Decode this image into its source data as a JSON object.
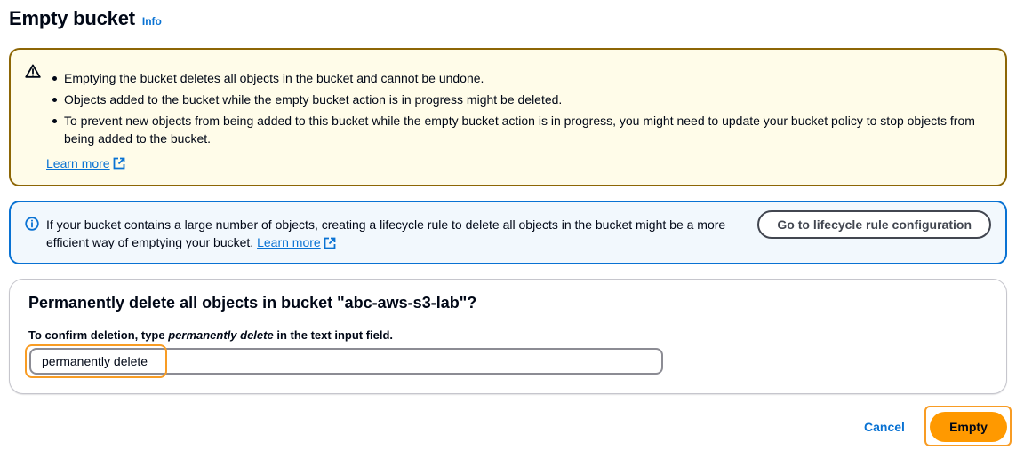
{
  "header": {
    "title": "Empty bucket",
    "info_label": "Info"
  },
  "warning": {
    "icon": "warning-icon",
    "items": [
      "Emptying the bucket deletes all objects in the bucket and cannot be undone.",
      "Objects added to the bucket while the empty bucket action is in progress might be deleted.",
      "To prevent new objects from being added to this bucket while the empty bucket action is in progress, you might need to update your bucket policy to stop objects from being added to the bucket."
    ],
    "learn_more": "Learn more",
    "color": "#8d6605"
  },
  "info_alert": {
    "icon": "info-icon",
    "text": "If your bucket contains a large number of objects, creating a lifecycle rule to delete all objects in the bucket might be a more efficient way of emptying your bucket.",
    "learn_more": "Learn more",
    "button_label": "Go to lifecycle rule configuration",
    "color": "#0972d3"
  },
  "confirm": {
    "title": "Permanently delete all objects in bucket \"abc-aws-s3-lab\"?",
    "label_prefix": "To confirm deletion, type ",
    "label_emphasis": "permanently delete",
    "label_suffix": " in the text input field.",
    "input_value": "permanently delete"
  },
  "footer": {
    "cancel_label": "Cancel",
    "empty_label": "Empty",
    "primary_color": "#ff9900",
    "highlight_color": "#f89c24"
  }
}
